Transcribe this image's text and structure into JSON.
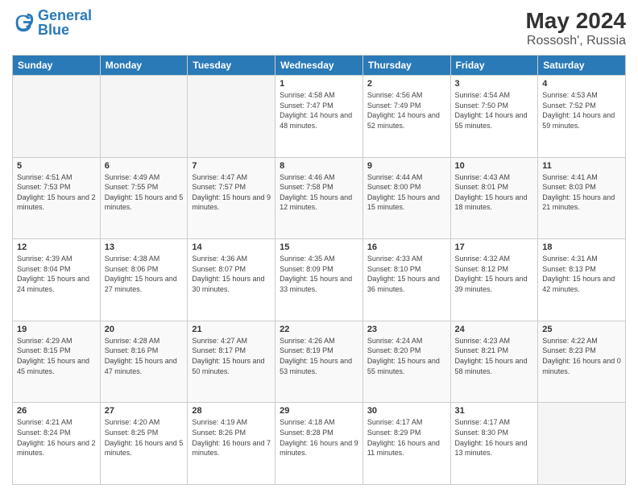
{
  "header": {
    "logo_text_general": "General",
    "logo_text_blue": "Blue",
    "title": "May 2024",
    "subtitle": "Rossosh', Russia"
  },
  "days_of_week": [
    "Sunday",
    "Monday",
    "Tuesday",
    "Wednesday",
    "Thursday",
    "Friday",
    "Saturday"
  ],
  "weeks": [
    [
      {
        "day": "",
        "sunrise": "",
        "sunset": "",
        "daylight": "",
        "empty": true
      },
      {
        "day": "",
        "sunrise": "",
        "sunset": "",
        "daylight": "",
        "empty": true
      },
      {
        "day": "",
        "sunrise": "",
        "sunset": "",
        "daylight": "",
        "empty": true
      },
      {
        "day": "1",
        "sunrise": "Sunrise: 4:58 AM",
        "sunset": "Sunset: 7:47 PM",
        "daylight": "Daylight: 14 hours and 48 minutes."
      },
      {
        "day": "2",
        "sunrise": "Sunrise: 4:56 AM",
        "sunset": "Sunset: 7:49 PM",
        "daylight": "Daylight: 14 hours and 52 minutes."
      },
      {
        "day": "3",
        "sunrise": "Sunrise: 4:54 AM",
        "sunset": "Sunset: 7:50 PM",
        "daylight": "Daylight: 14 hours and 55 minutes."
      },
      {
        "day": "4",
        "sunrise": "Sunrise: 4:53 AM",
        "sunset": "Sunset: 7:52 PM",
        "daylight": "Daylight: 14 hours and 59 minutes."
      }
    ],
    [
      {
        "day": "5",
        "sunrise": "Sunrise: 4:51 AM",
        "sunset": "Sunset: 7:53 PM",
        "daylight": "Daylight: 15 hours and 2 minutes."
      },
      {
        "day": "6",
        "sunrise": "Sunrise: 4:49 AM",
        "sunset": "Sunset: 7:55 PM",
        "daylight": "Daylight: 15 hours and 5 minutes."
      },
      {
        "day": "7",
        "sunrise": "Sunrise: 4:47 AM",
        "sunset": "Sunset: 7:57 PM",
        "daylight": "Daylight: 15 hours and 9 minutes."
      },
      {
        "day": "8",
        "sunrise": "Sunrise: 4:46 AM",
        "sunset": "Sunset: 7:58 PM",
        "daylight": "Daylight: 15 hours and 12 minutes."
      },
      {
        "day": "9",
        "sunrise": "Sunrise: 4:44 AM",
        "sunset": "Sunset: 8:00 PM",
        "daylight": "Daylight: 15 hours and 15 minutes."
      },
      {
        "day": "10",
        "sunrise": "Sunrise: 4:43 AM",
        "sunset": "Sunset: 8:01 PM",
        "daylight": "Daylight: 15 hours and 18 minutes."
      },
      {
        "day": "11",
        "sunrise": "Sunrise: 4:41 AM",
        "sunset": "Sunset: 8:03 PM",
        "daylight": "Daylight: 15 hours and 21 minutes."
      }
    ],
    [
      {
        "day": "12",
        "sunrise": "Sunrise: 4:39 AM",
        "sunset": "Sunset: 8:04 PM",
        "daylight": "Daylight: 15 hours and 24 minutes."
      },
      {
        "day": "13",
        "sunrise": "Sunrise: 4:38 AM",
        "sunset": "Sunset: 8:06 PM",
        "daylight": "Daylight: 15 hours and 27 minutes."
      },
      {
        "day": "14",
        "sunrise": "Sunrise: 4:36 AM",
        "sunset": "Sunset: 8:07 PM",
        "daylight": "Daylight: 15 hours and 30 minutes."
      },
      {
        "day": "15",
        "sunrise": "Sunrise: 4:35 AM",
        "sunset": "Sunset: 8:09 PM",
        "daylight": "Daylight: 15 hours and 33 minutes."
      },
      {
        "day": "16",
        "sunrise": "Sunrise: 4:33 AM",
        "sunset": "Sunset: 8:10 PM",
        "daylight": "Daylight: 15 hours and 36 minutes."
      },
      {
        "day": "17",
        "sunrise": "Sunrise: 4:32 AM",
        "sunset": "Sunset: 8:12 PM",
        "daylight": "Daylight: 15 hours and 39 minutes."
      },
      {
        "day": "18",
        "sunrise": "Sunrise: 4:31 AM",
        "sunset": "Sunset: 8:13 PM",
        "daylight": "Daylight: 15 hours and 42 minutes."
      }
    ],
    [
      {
        "day": "19",
        "sunrise": "Sunrise: 4:29 AM",
        "sunset": "Sunset: 8:15 PM",
        "daylight": "Daylight: 15 hours and 45 minutes."
      },
      {
        "day": "20",
        "sunrise": "Sunrise: 4:28 AM",
        "sunset": "Sunset: 8:16 PM",
        "daylight": "Daylight: 15 hours and 47 minutes."
      },
      {
        "day": "21",
        "sunrise": "Sunrise: 4:27 AM",
        "sunset": "Sunset: 8:17 PM",
        "daylight": "Daylight: 15 hours and 50 minutes."
      },
      {
        "day": "22",
        "sunrise": "Sunrise: 4:26 AM",
        "sunset": "Sunset: 8:19 PM",
        "daylight": "Daylight: 15 hours and 53 minutes."
      },
      {
        "day": "23",
        "sunrise": "Sunrise: 4:24 AM",
        "sunset": "Sunset: 8:20 PM",
        "daylight": "Daylight: 15 hours and 55 minutes."
      },
      {
        "day": "24",
        "sunrise": "Sunrise: 4:23 AM",
        "sunset": "Sunset: 8:21 PM",
        "daylight": "Daylight: 15 hours and 58 minutes."
      },
      {
        "day": "25",
        "sunrise": "Sunrise: 4:22 AM",
        "sunset": "Sunset: 8:23 PM",
        "daylight": "Daylight: 16 hours and 0 minutes."
      }
    ],
    [
      {
        "day": "26",
        "sunrise": "Sunrise: 4:21 AM",
        "sunset": "Sunset: 8:24 PM",
        "daylight": "Daylight: 16 hours and 2 minutes."
      },
      {
        "day": "27",
        "sunrise": "Sunrise: 4:20 AM",
        "sunset": "Sunset: 8:25 PM",
        "daylight": "Daylight: 16 hours and 5 minutes."
      },
      {
        "day": "28",
        "sunrise": "Sunrise: 4:19 AM",
        "sunset": "Sunset: 8:26 PM",
        "daylight": "Daylight: 16 hours and 7 minutes."
      },
      {
        "day": "29",
        "sunrise": "Sunrise: 4:18 AM",
        "sunset": "Sunset: 8:28 PM",
        "daylight": "Daylight: 16 hours and 9 minutes."
      },
      {
        "day": "30",
        "sunrise": "Sunrise: 4:17 AM",
        "sunset": "Sunset: 8:29 PM",
        "daylight": "Daylight: 16 hours and 11 minutes."
      },
      {
        "day": "31",
        "sunrise": "Sunrise: 4:17 AM",
        "sunset": "Sunset: 8:30 PM",
        "daylight": "Daylight: 16 hours and 13 minutes."
      },
      {
        "day": "",
        "sunrise": "",
        "sunset": "",
        "daylight": "",
        "empty": true
      }
    ]
  ]
}
